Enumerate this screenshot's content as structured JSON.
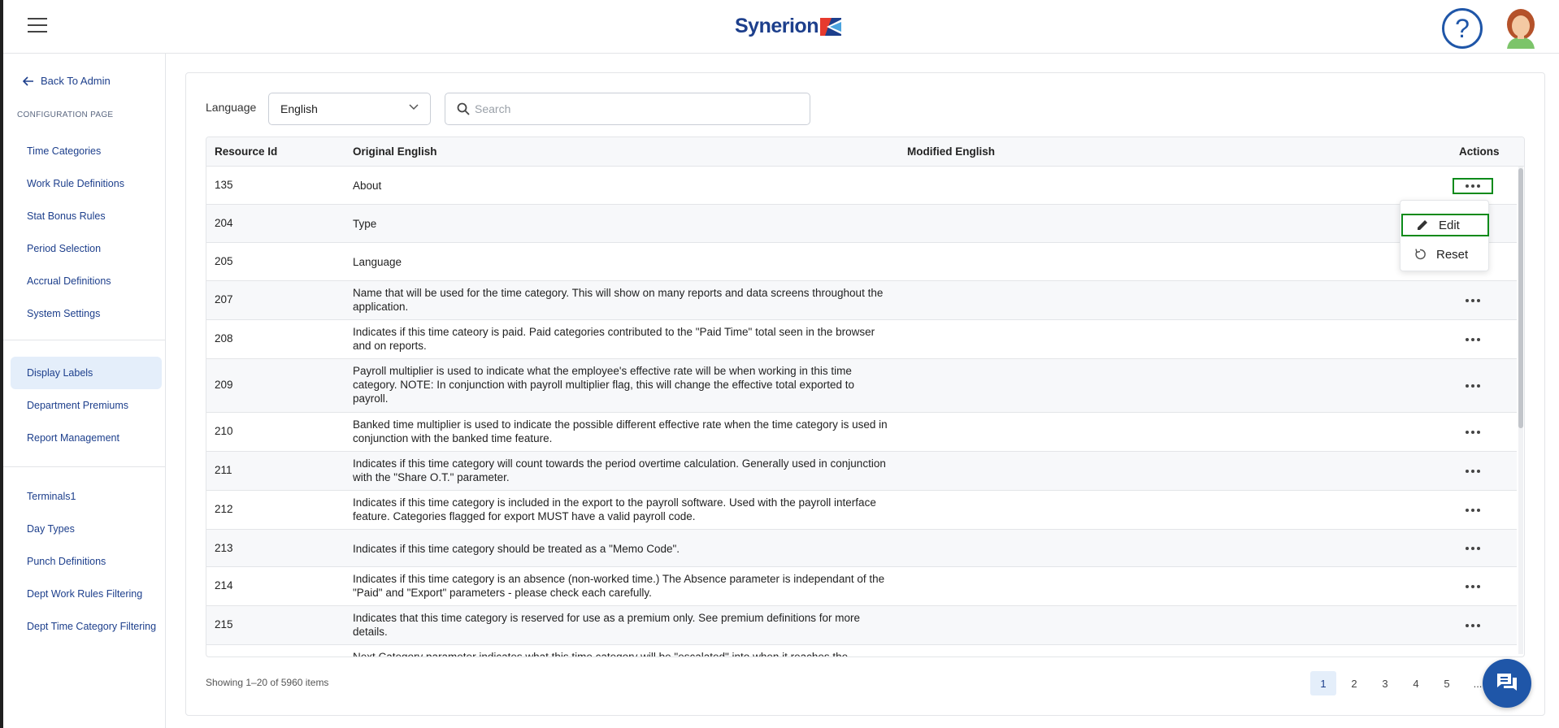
{
  "header": {
    "logo_text": "Synerion",
    "help_symbol": "?"
  },
  "sidebar": {
    "back_label": "Back To Admin",
    "section_label": "CONFIGURATION PAGE",
    "group1": [
      "Time Categories",
      "Work Rule Definitions",
      "Stat Bonus Rules",
      "Period Selection",
      "Accrual Definitions",
      "System Settings"
    ],
    "group2": [
      "Display Labels",
      "Department Premiums",
      "Report Management"
    ],
    "group3": [
      "Terminals1",
      "Day Types",
      "Punch Definitions",
      "Dept Work Rules Filtering",
      "Dept Time Category Filtering"
    ],
    "active_item": "Display Labels"
  },
  "filters": {
    "language_label": "Language",
    "language_value": "English",
    "search_placeholder": "Search"
  },
  "table": {
    "columns": [
      "Resource Id",
      "Original English",
      "Modified English",
      "Actions"
    ],
    "rows": [
      {
        "id": "135",
        "original": "About",
        "modified": ""
      },
      {
        "id": "204",
        "original": "Type",
        "modified": ""
      },
      {
        "id": "205",
        "original": "Language",
        "modified": ""
      },
      {
        "id": "207",
        "original": "Name that will be used for the time category. This will show on many reports and data screens throughout the application.",
        "modified": ""
      },
      {
        "id": "208",
        "original": "Indicates if this time cateory is paid. Paid categories contributed to the \"Paid Time\" total seen in the browser and on reports.",
        "modified": ""
      },
      {
        "id": "209",
        "original": "Payroll multiplier is used to indicate what the employee's effective rate will be when working in this time category. NOTE: In conjunction with payroll multiplier flag, this will change the effective total exported to payroll.",
        "modified": ""
      },
      {
        "id": "210",
        "original": "Banked time multiplier is used to indicate the possible different effective rate when the time category is used in conjunction with the banked time feature.",
        "modified": ""
      },
      {
        "id": "211",
        "original": "Indicates if this time category will count towards the period overtime calculation. Generally used in conjunction with the \"Share O.T.\" parameter.",
        "modified": ""
      },
      {
        "id": "212",
        "original": "Indicates if this time category is included in the export to the payroll software. Used with the payroll interface feature. Categories flagged for export MUST have a valid payroll code.",
        "modified": ""
      },
      {
        "id": "213",
        "original": "Indicates if this time category should be treated as a \"Memo Code\".",
        "modified": ""
      },
      {
        "id": "214",
        "original": "Indicates if this time category is an absence (non-worked time.) The Absence parameter is independant of the \"Paid\" and \"Export\" parameters - please check each carefully.",
        "modified": ""
      },
      {
        "id": "215",
        "original": "Indicates that this time category is reserved for use as a premium only. See premium definitions for more details.",
        "modified": ""
      },
      {
        "id": "",
        "original": "Next Category parameter indicates what this time category will be \"escalated\" into when it reaches the",
        "modified": ""
      }
    ]
  },
  "action_menu": {
    "items": [
      {
        "label": "Edit",
        "icon": "pencil-icon"
      },
      {
        "label": "Reset",
        "icon": "reset-icon"
      }
    ]
  },
  "footer": {
    "showing_text": "Showing 1–20 of 5960 items",
    "pages": [
      "1",
      "2",
      "3",
      "4",
      "5",
      "..."
    ],
    "current_page": "1"
  },
  "colors": {
    "brand_blue": "#1d3f8c",
    "accent_blue": "#1f56a8",
    "highlight_green": "#0a8a1a",
    "active_bg": "#e4eefa"
  }
}
